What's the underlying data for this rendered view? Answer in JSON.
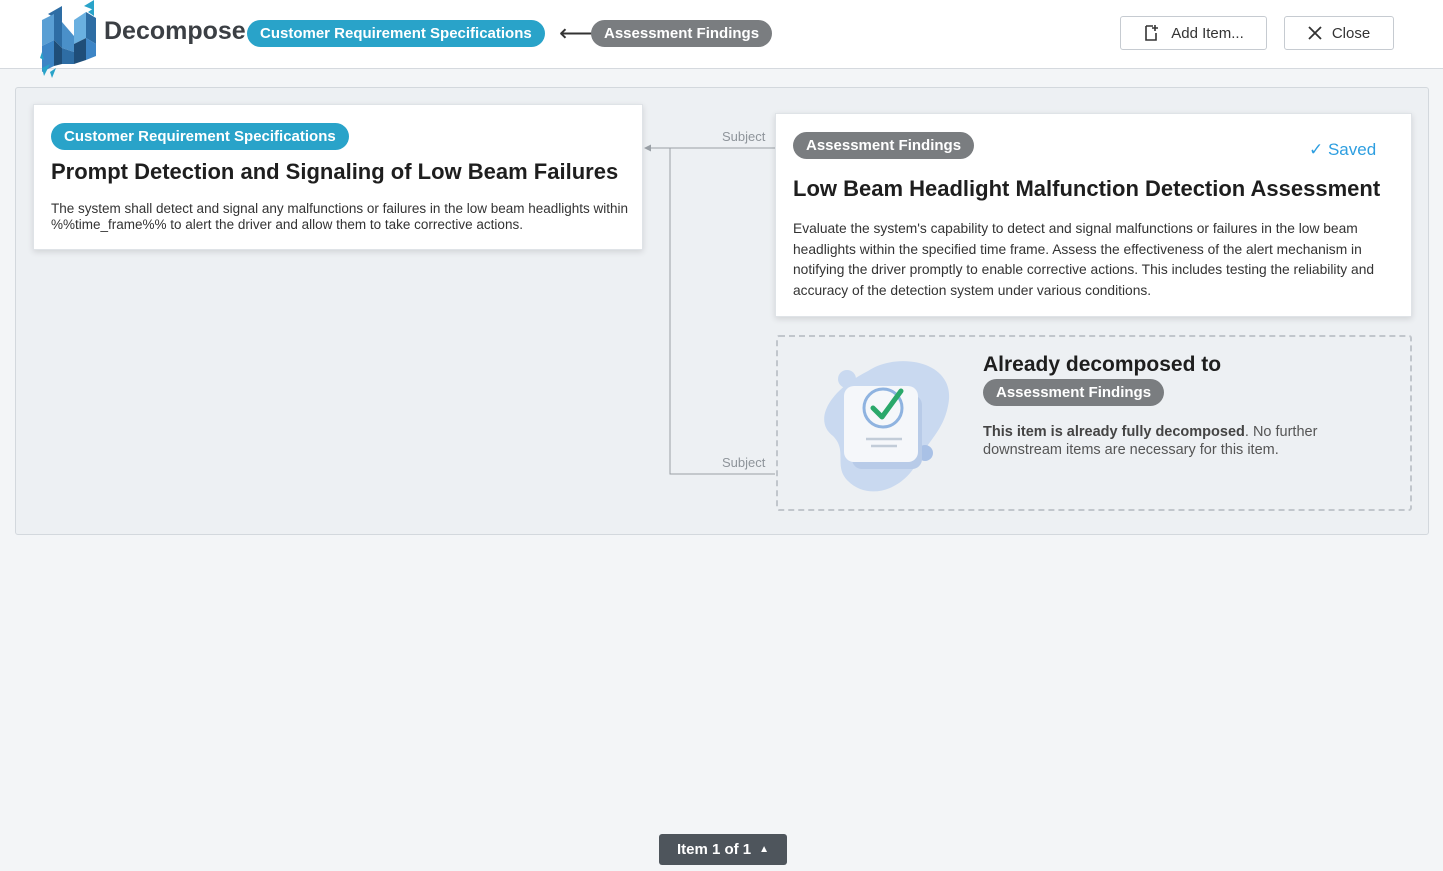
{
  "header": {
    "app_title": "Decompose",
    "source_type": "Customer Requirement Specifications",
    "arrow": "⟵",
    "target_type": "Assessment Findings",
    "add_item_label": "Add Item...",
    "close_label": "Close"
  },
  "source_card": {
    "type_label": "Customer Requirement Specifications",
    "title": "Prompt Detection and Signaling of Low Beam Failures",
    "description": "The system shall detect and signal any malfunctions or failures in the low beam headlights within %%time_frame%% to alert the driver and allow them to take corrective actions."
  },
  "connectors": {
    "label_top": "Subject",
    "label_bottom": "Subject"
  },
  "target_card": {
    "type_label": "Assessment Findings",
    "status": "✓ Saved",
    "title": "Low Beam Headlight Malfunction Detection Assessment",
    "description": "Evaluate the system's capability to detect and signal malfunctions or failures in the low beam headlights within the specified time frame. Assess the effectiveness of the alert mechanism in notifying the driver promptly to enable corrective actions. This includes testing the reliability and accuracy of the detection system under various conditions."
  },
  "decomposed_panel": {
    "title": "Already decomposed to",
    "type_label": "Assessment Findings",
    "message_bold": "This item is already fully decomposed",
    "message_rest": ". No further downstream items are necessary for this item."
  },
  "pager": {
    "label": "Item 1 of 1",
    "arrow": "▲"
  },
  "colors": {
    "accent_blue": "#29a3c9",
    "type_gray": "#7a7d80",
    "saved_blue": "#2d9ee0",
    "pager_bg": "#4e555c"
  }
}
